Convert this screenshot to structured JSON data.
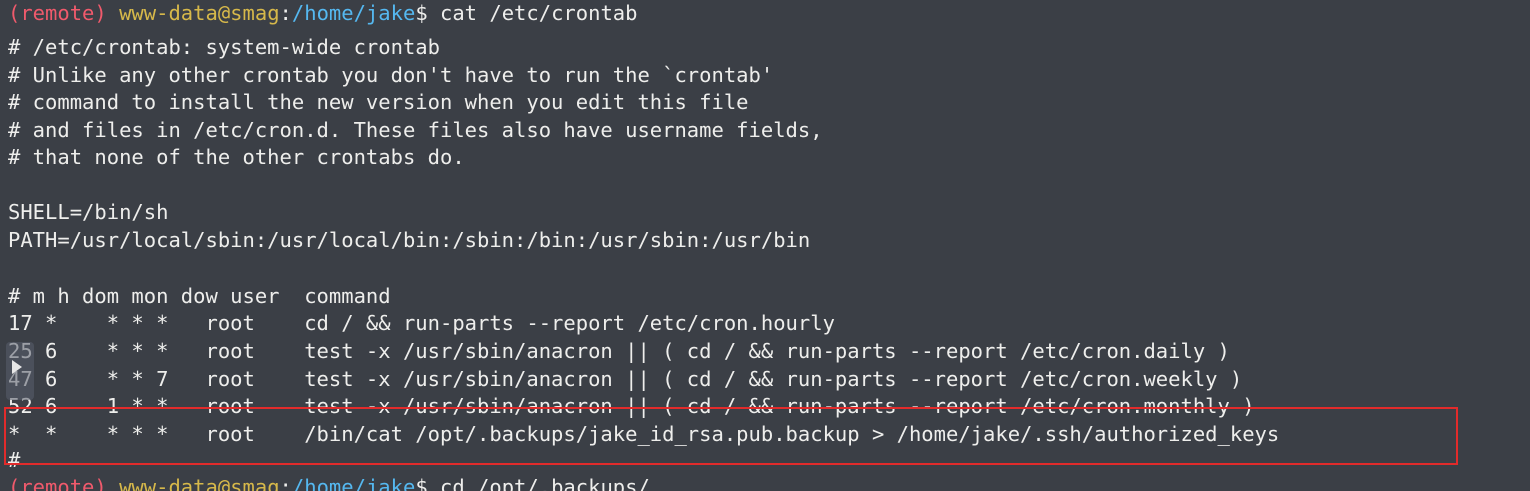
{
  "prompt": {
    "remote_tag": "(remote)",
    "user_host": "www-data@smag",
    "colon": ":",
    "cwd": "/home/jake",
    "dollar": "$",
    "command": " cat /etc/crontab"
  },
  "output_lines": [
    "# /etc/crontab: system-wide crontab",
    "# Unlike any other crontab you don't have to run the `crontab'",
    "# command to install the new version when you edit this file",
    "# and files in /etc/cron.d. These files also have username fields,",
    "# that none of the other crontabs do.",
    "",
    "SHELL=/bin/sh",
    "PATH=/usr/local/sbin:/usr/local/bin:/sbin:/bin:/usr/sbin:/usr/bin",
    "",
    "# m h dom mon dow user  command",
    "17 *    * * *   root    cd / && run-parts --report /etc/cron.hourly",
    "25 6    * * *   root    test -x /usr/sbin/anacron || ( cd / && run-parts --report /etc/cron.daily )",
    "47 6    * * 7   root    test -x /usr/sbin/anacron || ( cd / && run-parts --report /etc/cron.weekly )",
    "52 6    1 * *   root    test -x /usr/sbin/anacron || ( cd / && run-parts --report /etc/cron.monthly )",
    "*  *    * * *   root    /bin/cat /opt/.backups/jake_id_rsa.pub.backup > /home/jake/.ssh/authorized_keys",
    "#"
  ],
  "next_prompt": {
    "remote_tag": "(remote)",
    "user_host": "www-data@smag",
    "colon": ":",
    "cwd": "/home/jake",
    "dollar": "$",
    "command": " cd /opt/.backups/"
  },
  "colors": {
    "background": "#3b3f46",
    "remote": "#f05a6c",
    "user_host": "#d6b84a",
    "cwd": "#55b8f0",
    "text": "#eeeeec",
    "highlight_box": "#e22b2b"
  }
}
